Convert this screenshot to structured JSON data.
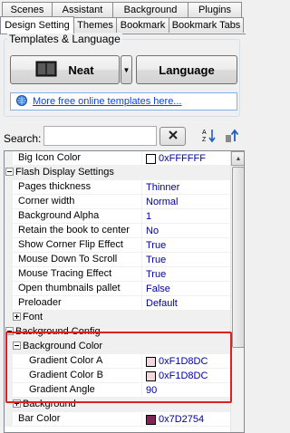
{
  "tabs_top": [
    "Scenes",
    "Assistant",
    "Background",
    "Plugins"
  ],
  "tabs_bottom": [
    "Design Setting",
    "Themes",
    "Bookmark",
    "Bookmark Tabs"
  ],
  "templates": {
    "group_title": "Templates & Language",
    "neat_label": "Neat",
    "language_label": "Language",
    "link_text": "More free online templates here..."
  },
  "search": {
    "label": "Search:",
    "value": ""
  },
  "properties": [
    {
      "name": "Big Icon Color",
      "value": "0xFFFFFF",
      "swatch": "#FFFFFF",
      "indent": 1
    },
    {
      "name": "Flash Display Settings",
      "category": true,
      "expanded": true,
      "indent": 0
    },
    {
      "name": "Pages thickness",
      "value": "Thinner",
      "indent": 1
    },
    {
      "name": "Corner width",
      "value": "Normal",
      "indent": 1
    },
    {
      "name": "Background Alpha",
      "value": "1",
      "indent": 1
    },
    {
      "name": "Retain the book to center",
      "value": "No",
      "indent": 1
    },
    {
      "name": "Show Corner Flip Effect",
      "value": "True",
      "indent": 1
    },
    {
      "name": "Mouse Down To Scroll",
      "value": "True",
      "indent": 1
    },
    {
      "name": "Mouse Tracing Effect",
      "value": "True",
      "indent": 1
    },
    {
      "name": "Open thumbnails pallet",
      "value": "False",
      "indent": 1
    },
    {
      "name": "Preloader",
      "value": "Default",
      "indent": 1
    },
    {
      "name": "Font",
      "category": true,
      "expanded": false,
      "indent": 1
    },
    {
      "name": "Background Config",
      "category": true,
      "expanded": true,
      "indent": 0
    },
    {
      "name": "Background Color",
      "category": true,
      "expanded": true,
      "indent": 1
    },
    {
      "name": "Gradient Color A",
      "value": "0xF1D8DC",
      "swatch": "#F1D8DC",
      "indent": 2
    },
    {
      "name": "Gradient Color B",
      "value": "0xF1D8DC",
      "swatch": "#F1D8DC",
      "indent": 2
    },
    {
      "name": "Gradient Angle",
      "value": "90",
      "indent": 2
    },
    {
      "name": "Background",
      "category": true,
      "expanded": false,
      "indent": 1
    },
    {
      "name": "Bar Color",
      "value": "0x7D2754",
      "swatch": "#7D2754",
      "indent": 1
    }
  ]
}
